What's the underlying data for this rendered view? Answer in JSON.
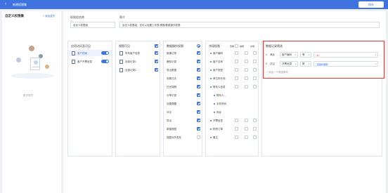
{
  "header": {
    "back_icon": "chevron-left-icon",
    "title": "新建权限集",
    "save_label": "保存"
  },
  "left": {
    "title": "自定义权限集",
    "link": "+ 添加成员",
    "caption": "暂无成员"
  },
  "form": {
    "name_label": "权限组名称",
    "name_value": "自定义权限组",
    "desc_label": "简介",
    "desc_value": "自定义权限组，仅可以设置工作表/视图/数据操作权限"
  },
  "columns": {
    "apps": {
      "title": "应用访问及可见",
      "items": [
        {
          "label": "客户档案",
          "on": true
        },
        {
          "label": "客户开票信息",
          "on": true
        }
      ]
    },
    "views": {
      "title": "视图可见",
      "items": [
        "所有客户信息",
        "全部记录1",
        "全部记录2"
      ]
    },
    "ops": {
      "title": "数据操作权限",
      "items": [
        "新建记录",
        "删除记录",
        "导出数据",
        "查看日志",
        "已完成删",
        "分享记录",
        "设置提醒",
        "评论",
        "导出",
        "新建视图",
        "视图对外发布"
      ]
    },
    "fields": {
      "title": "字段权限",
      "sub_labels": [
        "查看",
        "编辑",
        "必填"
      ],
      "items": [
        "客户编码",
        "客户名称",
        "客户类型",
        "单位所在地",
        "联系人信息",
        "联系人...",
        "手机号码",
        "地址",
        "开票信息",
        "物资订单",
        "备注"
      ]
    }
  },
  "conditions": {
    "title": "数据记录筛选",
    "rows": [
      {
        "num": "1",
        "op": "满足",
        "field": "客户编码",
        "cmp": "等",
        "tag": "A"
      },
      {
        "num": "2",
        "op": "并且",
        "field": "开票信息",
        "cmp": "是",
        "tag": "高级扩展项"
      }
    ],
    "add_label": "+ 添加一个筛选条件"
  },
  "colors": {
    "accent": "#3f74e0",
    "highlight": "#e53935"
  }
}
